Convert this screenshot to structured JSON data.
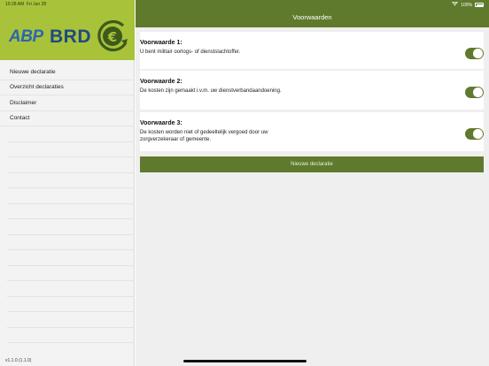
{
  "statusbar": {
    "time": "10:28 AM",
    "date": "Fri Jun 28",
    "battery": "100%"
  },
  "sidebar": {
    "logo": {
      "text_left": "ABP",
      "text_right": "BRD",
      "symbol": "€"
    },
    "items": [
      {
        "label": "Nieuwe declaratie"
      },
      {
        "label": "Overzicht declaraties"
      },
      {
        "label": "Disclaimer"
      },
      {
        "label": "Contact"
      }
    ],
    "version": "v1.1.0 (1.1.0)"
  },
  "main": {
    "title": "Voorwaarden",
    "conditions": [
      {
        "title": "Voorwaarde 1:",
        "text": "U bent militair oorlogs- of dienstslachtoffer.",
        "enabled": true
      },
      {
        "title": "Voorwaarde 2:",
        "text": "De kosten zijn gemaakt i.v.m. uw dienstverbandaandoening.",
        "enabled": true
      },
      {
        "title": "Voorwaarde 3:",
        "text": "De kosten worden niet of gedeeltelijk vergoed door uw zorgverzekeraar of gemeente.",
        "enabled": true
      }
    ],
    "button_label": "Nieuwe declaratie"
  },
  "colors": {
    "brand_green": "#5f7a2d",
    "logo_green": "#a8c23a",
    "logo_blue": "#2b66b0"
  }
}
